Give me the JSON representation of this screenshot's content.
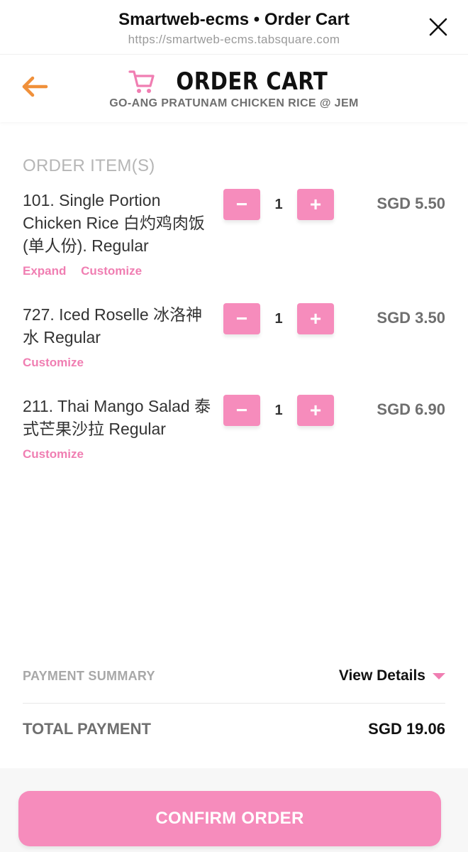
{
  "browser": {
    "title": "Smartweb-ecms • Order Cart",
    "url": "https://smartweb-ecms.tabsquare.com",
    "close_icon": "close-icon"
  },
  "header": {
    "back_icon": "arrow-left-icon",
    "cart_icon": "shopping-cart-icon",
    "title": "ORDER CART",
    "subtitle": "GO-ANG PRATUNAM CHICKEN RICE @ JEM"
  },
  "order": {
    "section_label": "ORDER ITEM(S)",
    "items": [
      {
        "name": "101. Single Portion Chicken Rice 白灼鸡肉饭 (单人份). Regular",
        "qty": "1",
        "price": "SGD 5.50",
        "expand": "Expand",
        "customize": "Customize"
      },
      {
        "name": "727. Iced Roselle 冰洛神水 Regular",
        "qty": "1",
        "price": "SGD 3.50",
        "customize": "Customize"
      },
      {
        "name": "211. Thai Mango Salad 泰式芒果沙拉 Regular",
        "qty": "1",
        "price": "SGD 6.90",
        "customize": "Customize"
      }
    ],
    "minus_label": "−",
    "plus_label": "+"
  },
  "summary": {
    "payment_summary_label": "PAYMENT SUMMARY",
    "view_details_label": "View Details",
    "total_label": "TOTAL PAYMENT",
    "total_value": "SGD 19.06"
  },
  "footer": {
    "confirm_label": "CONFIRM ORDER"
  },
  "colors": {
    "accent_pink": "#f68cbc",
    "link_pink": "#f07eb2",
    "back_orange": "#f0903a"
  }
}
